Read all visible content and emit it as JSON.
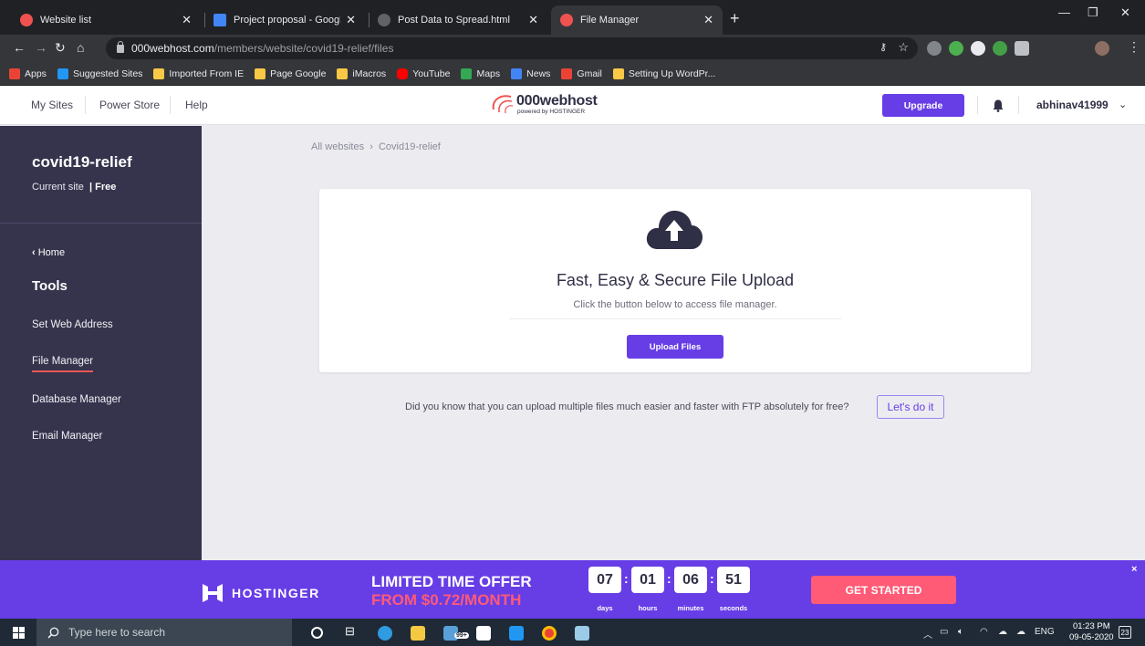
{
  "browser": {
    "tabs": [
      {
        "title": "Website list",
        "active": false,
        "icon": "000webhost-favicon",
        "color": "#ef5350"
      },
      {
        "title": "Project proposal - Google Docs",
        "active": false,
        "icon": "google-docs-icon",
        "color": "#4285f4"
      },
      {
        "title": "Post Data to Spread.html",
        "active": false,
        "icon": "globe-icon",
        "color": "#5f6368"
      },
      {
        "title": "File Manager",
        "active": true,
        "icon": "000webhost-favicon",
        "color": "#ef5350"
      }
    ],
    "url_host": "000webhost.com",
    "url_path": "/members/website/covid19-relief/files",
    "bookmarks": [
      {
        "label": "Apps",
        "icon": "apps-grid-icon",
        "color": "#ea4335"
      },
      {
        "label": "Suggested Sites",
        "icon": "bing-icon",
        "color": "#2196f3"
      },
      {
        "label": "Imported From IE",
        "icon": "folder-icon",
        "color": "#f9c846"
      },
      {
        "label": "Page Google",
        "icon": "folder-icon",
        "color": "#f9c846"
      },
      {
        "label": "iMacros",
        "icon": "folder-icon",
        "color": "#f9c846"
      },
      {
        "label": "YouTube",
        "icon": "youtube-icon",
        "color": "#ff0000"
      },
      {
        "label": "Maps",
        "icon": "maps-icon",
        "color": "#34a853"
      },
      {
        "label": "News",
        "icon": "news-icon",
        "color": "#4285f4"
      },
      {
        "label": "Gmail",
        "icon": "gmail-icon",
        "color": "#ea4335"
      },
      {
        "label": "Setting Up WordPr...",
        "icon": "wordpress-icon",
        "color": "#f9c846"
      }
    ]
  },
  "header": {
    "nav": [
      "My Sites",
      "Power Store",
      "Help"
    ],
    "logo_text": "000webhost",
    "logo_sub": "powered by HOSTINGER",
    "upgrade_label": "Upgrade",
    "username": "abhinav41999"
  },
  "sidebar": {
    "site_name": "covid19-relief",
    "current_site_label": "Current site",
    "plan": "| Free",
    "home_label": "Home",
    "tools_label": "Tools",
    "items": [
      {
        "label": "Set Web Address",
        "active": false
      },
      {
        "label": "File Manager",
        "active": true
      },
      {
        "label": "Database Manager",
        "active": false
      },
      {
        "label": "Email Manager",
        "active": false
      }
    ]
  },
  "main": {
    "breadcrumb": [
      "All websites",
      "Covid19-relief"
    ],
    "card_title": "Fast, Easy & Secure File Upload",
    "card_subtitle": "Click the button below to access file manager.",
    "upload_button": "Upload Files",
    "ftp_text": "Did you know that you can upload multiple files much easier and faster with FTP absolutely for free?",
    "ftp_button": "Let's do it"
  },
  "promo": {
    "brand": "HOSTINGER",
    "offer_line1": "LIMITED TIME OFFER",
    "offer_line2": "FROM $0.72/MONTH",
    "countdown": [
      {
        "value": "07",
        "unit": "days"
      },
      {
        "value": "01",
        "unit": "hours"
      },
      {
        "value": "06",
        "unit": "minutes"
      },
      {
        "value": "51",
        "unit": "seconds"
      }
    ],
    "cta": "GET STARTED",
    "close_label": "×"
  },
  "taskbar": {
    "search_placeholder": "Type here to search",
    "language": "ENG",
    "time": "01:23 PM",
    "date": "09-05-2020",
    "notification_count": "23",
    "store_badge": "99+"
  },
  "colors": {
    "accent": "#673de6",
    "sidebar": "#36344d",
    "promo_pink": "#ff5a76"
  }
}
